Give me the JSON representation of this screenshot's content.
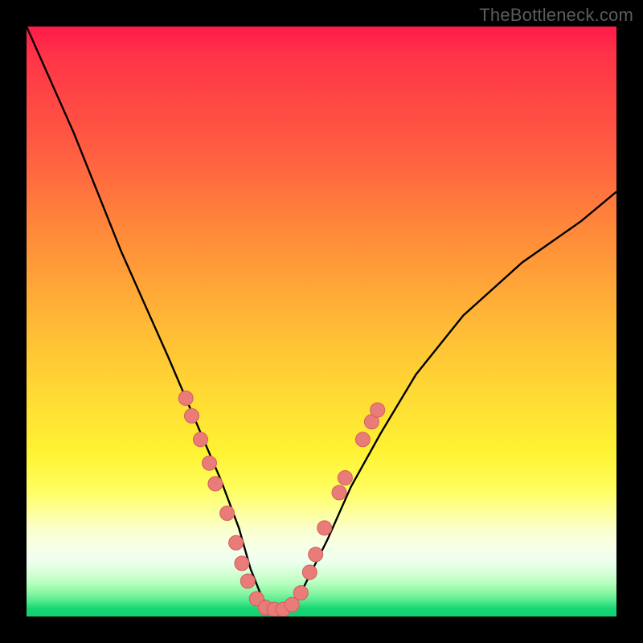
{
  "watermark": "TheBottleneck.com",
  "colors": {
    "frame_bg": "#000000",
    "curve_stroke": "#000000",
    "marker_fill": "#e97b78",
    "marker_stroke": "#d25f5c",
    "grad_top": "#ff1a4b",
    "grad_mid": "#ffe433",
    "grad_bottom": "#13cf72"
  },
  "chart_data": {
    "type": "line",
    "title": "",
    "xlabel": "",
    "ylabel": "",
    "xlim": [
      0,
      100
    ],
    "ylim": [
      0,
      100
    ],
    "note": "Axes have no tick labels; values are geometric positions (0=left/bottom, 100=right/top) inferred from pixel layout. The curve is a stylized V-shaped bottleneck curve with its minimum near x≈40, y≈0.",
    "series": [
      {
        "name": "bottleneck-curve",
        "x": [
          0,
          4,
          8,
          12,
          16,
          20,
          24,
          27,
          30,
          33,
          36,
          38,
          40,
          42,
          44,
          46,
          48,
          51,
          55,
          60,
          66,
          74,
          84,
          94,
          100
        ],
        "y": [
          100,
          91,
          82,
          72,
          62,
          53,
          44,
          37,
          30,
          23,
          15,
          8,
          3,
          1,
          1,
          3,
          7,
          13,
          22,
          31,
          41,
          51,
          60,
          67,
          72
        ]
      }
    ],
    "markers": {
      "name": "highlight-dots",
      "note": "Pink circular markers clustered near the bottom of the V on both arms and along the trough.",
      "points": [
        {
          "x": 27.0,
          "y": 37.0
        },
        {
          "x": 28.0,
          "y": 34.0
        },
        {
          "x": 29.5,
          "y": 30.0
        },
        {
          "x": 31.0,
          "y": 26.0
        },
        {
          "x": 32.0,
          "y": 22.5
        },
        {
          "x": 34.0,
          "y": 17.5
        },
        {
          "x": 35.5,
          "y": 12.5
        },
        {
          "x": 36.5,
          "y": 9.0
        },
        {
          "x": 37.5,
          "y": 6.0
        },
        {
          "x": 39.0,
          "y": 3.0
        },
        {
          "x": 40.5,
          "y": 1.5
        },
        {
          "x": 42.0,
          "y": 1.2
        },
        {
          "x": 43.5,
          "y": 1.2
        },
        {
          "x": 45.0,
          "y": 2.0
        },
        {
          "x": 46.5,
          "y": 4.0
        },
        {
          "x": 48.0,
          "y": 7.5
        },
        {
          "x": 49.0,
          "y": 10.5
        },
        {
          "x": 50.5,
          "y": 15.0
        },
        {
          "x": 53.0,
          "y": 21.0
        },
        {
          "x": 54.0,
          "y": 23.5
        },
        {
          "x": 57.0,
          "y": 30.0
        },
        {
          "x": 58.5,
          "y": 33.0
        },
        {
          "x": 59.5,
          "y": 35.0
        }
      ]
    }
  }
}
